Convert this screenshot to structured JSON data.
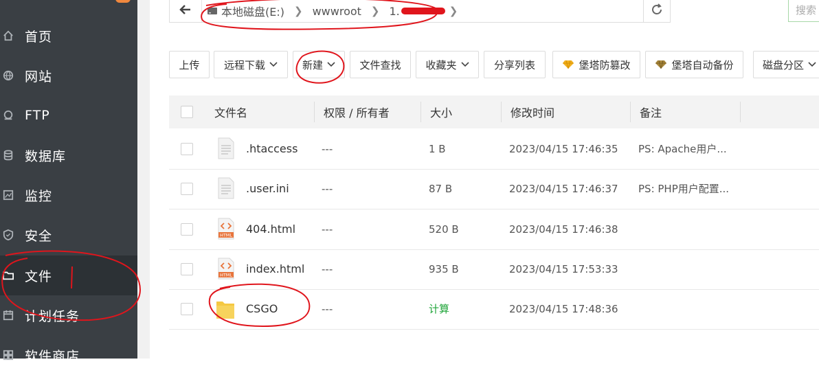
{
  "sidebar": {
    "items": [
      {
        "label": "首页",
        "icon": "home-icon"
      },
      {
        "label": "网站",
        "icon": "globe-icon"
      },
      {
        "label": "FTP",
        "icon": "ftp-icon"
      },
      {
        "label": "数据库",
        "icon": "database-icon"
      },
      {
        "label": "监控",
        "icon": "monitor-icon"
      },
      {
        "label": "安全",
        "icon": "shield-icon"
      },
      {
        "label": "文件",
        "icon": "folder-icon",
        "active": true
      },
      {
        "label": "计划任务",
        "icon": "calendar-icon"
      },
      {
        "label": "软件商店",
        "icon": "store-icon"
      }
    ]
  },
  "path": {
    "drive": "本地磁盘(E:)",
    "segment1": "wwwroot",
    "segment2": "1."
  },
  "search": {
    "placeholder": "搜索"
  },
  "toolbar": {
    "upload": "上传",
    "remote_download": "远程下载",
    "new": "新建",
    "find": "文件查找",
    "favorites": "收藏夹",
    "share_list": "分享列表",
    "tamper_proof": "堡塔防篡改",
    "auto_backup": "堡塔自动备份",
    "disk_partition": "磁盘分区"
  },
  "table": {
    "headers": {
      "name": "文件名",
      "perm": "权限 / 所有者",
      "size": "大小",
      "mtime": "修改时间",
      "note": "备注"
    },
    "rows": [
      {
        "name": ".htaccess",
        "type": "file",
        "perm": "---",
        "size": "1 B",
        "mtime": "2023/04/15 17:46:35",
        "note": "PS: Apache用户..."
      },
      {
        "name": ".user.ini",
        "type": "file",
        "perm": "---",
        "size": "87 B",
        "mtime": "2023/04/15 17:46:37",
        "note": "PS: PHP用户配置..."
      },
      {
        "name": "404.html",
        "type": "html",
        "perm": "---",
        "size": "520 B",
        "mtime": "2023/04/15 17:46:38",
        "note": ""
      },
      {
        "name": "index.html",
        "type": "html",
        "perm": "---",
        "size": "935 B",
        "mtime": "2023/04/15 17:53:33",
        "note": ""
      },
      {
        "name": "CSGO",
        "type": "folder",
        "perm": "---",
        "size": "计算",
        "mtime": "2023/04/15 17:48:36",
        "note": ""
      }
    ]
  },
  "html_icon_text": "HTML",
  "colors": {
    "sidebar_bg": "#3a3f44",
    "accent_green": "#20a53a",
    "annotation_red": "#e0151c",
    "folder_yellow": "#f5c842"
  }
}
